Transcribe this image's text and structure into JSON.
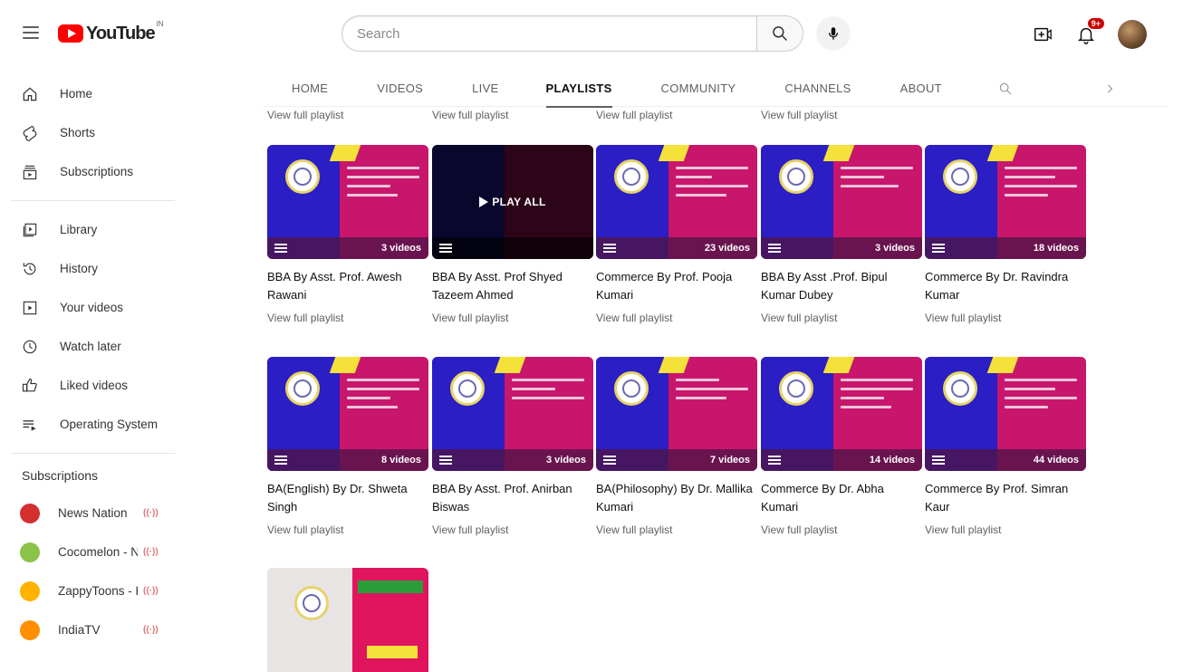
{
  "header": {
    "logo_text": "YouTube",
    "logo_country": "IN",
    "search_placeholder": "Search",
    "notification_count": "9+",
    "icons": [
      "menu-icon",
      "search-icon",
      "mic-icon",
      "create-icon",
      "bell-icon"
    ]
  },
  "sidebar": {
    "main": [
      {
        "label": "Home",
        "icon": "home-icon"
      },
      {
        "label": "Shorts",
        "icon": "shorts-icon"
      },
      {
        "label": "Subscriptions",
        "icon": "subscriptions-icon"
      }
    ],
    "library": [
      {
        "label": "Library",
        "icon": "library-icon"
      },
      {
        "label": "History",
        "icon": "history-icon"
      },
      {
        "label": "Your videos",
        "icon": "your-videos-icon"
      },
      {
        "label": "Watch later",
        "icon": "watch-later-icon"
      },
      {
        "label": "Liked videos",
        "icon": "liked-icon"
      },
      {
        "label": "Operating System",
        "icon": "playlist-icon"
      }
    ],
    "subscriptions_heading": "Subscriptions",
    "subscriptions": [
      {
        "name": "News Nation",
        "color": "#d32f2f"
      },
      {
        "name": "Cocomelon - Nur...",
        "color": "#8bc34a"
      },
      {
        "name": "ZappyToons - Hi...",
        "color": "#ffb300"
      },
      {
        "name": "IndiaTV",
        "color": "#ff8f00"
      }
    ],
    "live_symbol": "((·))"
  },
  "tabs": [
    {
      "label": "HOME",
      "active": false
    },
    {
      "label": "VIDEOS",
      "active": false
    },
    {
      "label": "LIVE",
      "active": false
    },
    {
      "label": "PLAYLISTS",
      "active": true
    },
    {
      "label": "COMMUNITY",
      "active": false
    },
    {
      "label": "CHANNELS",
      "active": false
    },
    {
      "label": "ABOUT",
      "active": false
    }
  ],
  "previous_row_links": [
    "View full playlist",
    "View full playlist",
    "View full playlist",
    "View full playlist"
  ],
  "playlists": [
    {
      "title": "BBA By Asst. Prof. Awesh Rawani",
      "count": "3 videos",
      "link": "View full playlist"
    },
    {
      "title": "BBA By Asst. Prof Shyed Tazeem Ahmed",
      "count": "",
      "link": "View full playlist",
      "play_all": "PLAY ALL"
    },
    {
      "title": "Commerce By Prof. Pooja Kumari",
      "count": "23 videos",
      "link": "View full playlist"
    },
    {
      "title": "BBA By Asst .Prof. Bipul Kumar Dubey",
      "count": "3 videos",
      "link": "View full playlist"
    },
    {
      "title": "Commerce By Dr. Ravindra Kumar",
      "count": "18 videos",
      "link": "View full playlist"
    },
    {
      "title": "BA(English) By Dr. Shweta Singh",
      "count": "8 videos",
      "link": "View full playlist"
    },
    {
      "title": "BBA By Asst. Prof. Anirban Biswas",
      "count": "3 videos",
      "link": "View full playlist"
    },
    {
      "title": "BA(Philosophy) By Dr. Mallika Kumari",
      "count": "7 videos",
      "link": "View full playlist"
    },
    {
      "title": "Commerce By Dr. Abha Kumari",
      "count": "14 videos",
      "link": "View full playlist"
    },
    {
      "title": "Commerce By Prof. Simran Kaur",
      "count": "44 videos",
      "link": "View full playlist"
    }
  ],
  "thumb_colors": {
    "blue": "#2a1ec4",
    "magenta": "#c8166d",
    "yellow": "#f4e23a"
  }
}
